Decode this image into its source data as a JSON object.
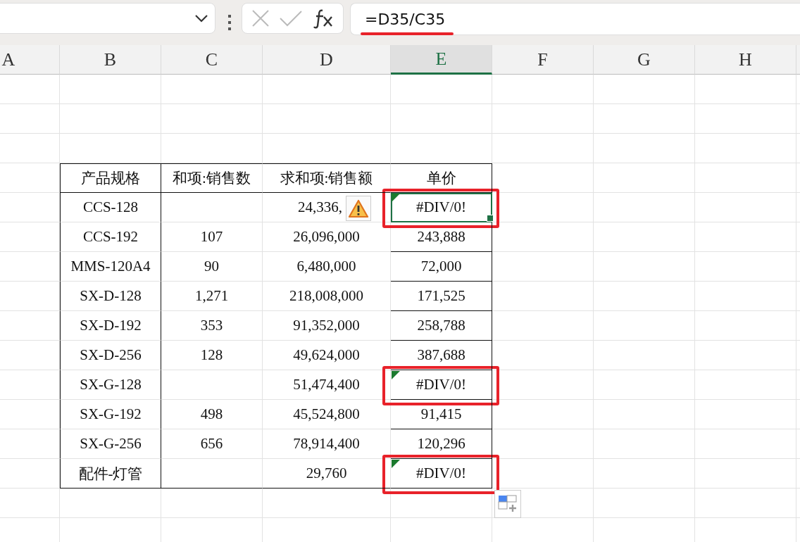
{
  "formula_bar": {
    "formula": "=D35/C35",
    "underlined": true
  },
  "columns": [
    {
      "label": "A",
      "selected": false
    },
    {
      "label": "B",
      "selected": false
    },
    {
      "label": "C",
      "selected": false
    },
    {
      "label": "D",
      "selected": false
    },
    {
      "label": "E",
      "selected": true
    },
    {
      "label": "F",
      "selected": false
    },
    {
      "label": "G",
      "selected": false
    },
    {
      "label": "H",
      "selected": false
    }
  ],
  "table": {
    "headers": [
      "产品规格",
      "和项:销售数",
      "求和项:销售额",
      "单价"
    ],
    "rows": [
      {
        "spec": "CCS-128",
        "amount": "24,336,",
        "price": "#DIV/0!",
        "error": true,
        "selected": true,
        "circled": true,
        "warning": true
      },
      {
        "spec": "CCS-192",
        "quantity": "107",
        "amount": "26,096,000",
        "price": "243,888",
        "error": false,
        "selected": false,
        "circled": false,
        "warning": false
      },
      {
        "spec": "MMS-120A4",
        "quantity": "90",
        "amount": "6,480,000",
        "price": "72,000",
        "error": false,
        "selected": false,
        "circled": false,
        "warning": false
      },
      {
        "spec": "SX-D-128",
        "quantity": "1,271",
        "amount": "218,008,000",
        "price": "171,525",
        "error": false,
        "selected": false,
        "circled": false,
        "warning": false
      },
      {
        "spec": "SX-D-192",
        "quantity": "353",
        "amount": "91,352,000",
        "price": "258,788",
        "error": false,
        "selected": false,
        "circled": false,
        "warning": false
      },
      {
        "spec": "SX-D-256",
        "quantity": "128",
        "amount": "49,624,000",
        "price": "387,688",
        "error": false,
        "selected": false,
        "circled": false,
        "warning": false
      },
      {
        "spec": "SX-G-128",
        "amount": "51,474,400",
        "price": "#DIV/0!",
        "error": true,
        "selected": false,
        "circled": true,
        "warning": false
      },
      {
        "spec": "SX-G-192",
        "quantity": "498",
        "amount": "45,524,800",
        "price": "91,415",
        "error": false,
        "selected": false,
        "circled": false,
        "warning": false
      },
      {
        "spec": "SX-G-256",
        "quantity": "656",
        "amount": "78,914,400",
        "price": "120,296",
        "error": false,
        "selected": false,
        "circled": false,
        "warning": false
      },
      {
        "spec": "配件-灯管",
        "amount": "29,760",
        "price": "#DIV/0!",
        "error": true,
        "selected": false,
        "circled": true,
        "warning": false
      }
    ]
  }
}
